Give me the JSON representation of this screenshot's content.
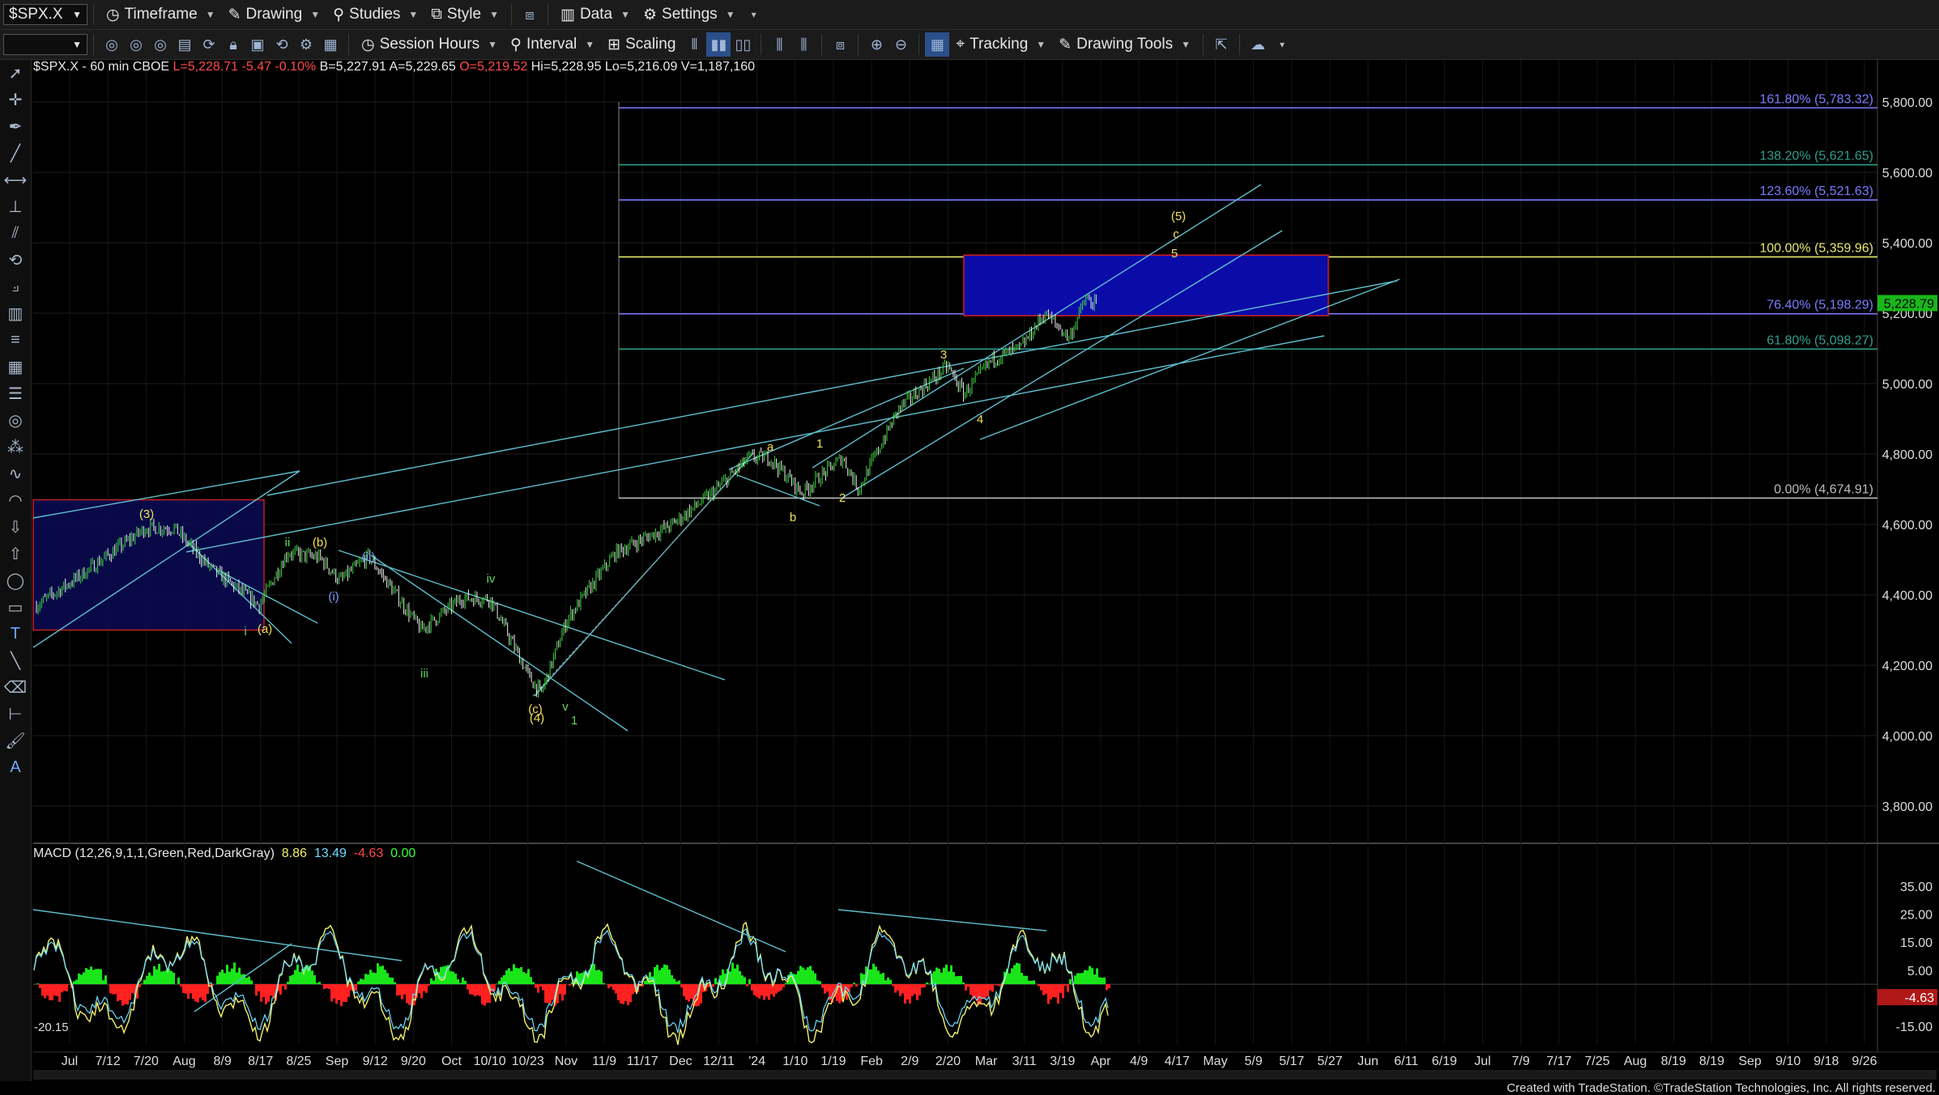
{
  "toolbar1": {
    "symbol": "$SPX.X",
    "items": [
      "Timeframe",
      "Drawing",
      "Studies",
      "Style",
      "Data",
      "Settings"
    ]
  },
  "toolbar2": {
    "items": [
      "Session Hours",
      "Interval",
      "Scaling",
      "Tracking",
      "Drawing Tools"
    ]
  },
  "header": {
    "symbol": "$SPX.X - 60 min",
    "exchange": "CBOE",
    "last": "L=5,228.71",
    "change": "-5.47",
    "change_pct": "-0.10%",
    "bid": "B=5,227.91",
    "ask": "A=5,229.65",
    "open": "O=5,219.52",
    "high": "Hi=5,228.95",
    "low": "Lo=5,216.09",
    "volume": "V=1,187,160"
  },
  "macd_header": {
    "label": "MACD (12,26,9,1,1,Green,Red,DarkGray)",
    "v1": "8.86",
    "v2": "13.49",
    "v3": "-4.63",
    "v4": "0.00",
    "colors": [
      "#f1f16c",
      "#6fdcff",
      "#ff4a4a",
      "#37ff37"
    ]
  },
  "price_axis": {
    "ticks": [
      "5,800.00",
      "5,600.00",
      "5,400.00",
      "5,200.00",
      "5,000.00",
      "4,800.00",
      "4,600.00",
      "4,400.00",
      "4,200.00",
      "4,000.00",
      "3,800.00"
    ],
    "last_price": "5,228.79"
  },
  "macd_axis": {
    "ticks": [
      "35.00",
      "25.00",
      "15.00",
      "5.00",
      "-15.00"
    ],
    "current": "-4.63",
    "min_label": "-20.15"
  },
  "time_axis": [
    "Jul",
    "7/12",
    "7/20",
    "Aug",
    "8/9",
    "8/17",
    "8/25",
    "Sep",
    "9/12",
    "9/20",
    "Oct",
    "10/10",
    "10/23",
    "Nov",
    "11/9",
    "11/17",
    "Dec",
    "12/11",
    "'24",
    "1/10",
    "1/19",
    "Feb",
    "2/9",
    "2/20",
    "Mar",
    "3/11",
    "3/19",
    "Apr",
    "4/9",
    "4/17",
    "May",
    "5/9",
    "5/17",
    "5/27",
    "Jun",
    "6/11",
    "6/19",
    "Jul",
    "7/9",
    "7/17",
    "7/25",
    "Aug",
    "8/19",
    "8/19",
    "Sep",
    "9/10",
    "9/18",
    "9/26"
  ],
  "fib_levels": [
    {
      "label": "161.80% (5,783.32)",
      "value": 5783.32,
      "color": "#7b7bff"
    },
    {
      "label": "138.20% (5,621.65)",
      "value": 5621.65,
      "color": "#2f9e8e"
    },
    {
      "label": "123.60% (5,521.63)",
      "value": 5521.63,
      "color": "#7b7bff"
    },
    {
      "label": "100.00% (5,359.96)",
      "value": 5359.96,
      "color": "#e8e86a"
    },
    {
      "label": "76.40% (5,198.29)",
      "value": 5198.29,
      "color": "#7b7bff"
    },
    {
      "label": "61.80% (5,098.27)",
      "value": 5098.27,
      "color": "#2f9e8e"
    },
    {
      "label": "0.00% (4,674.91)",
      "value": 4674.91,
      "color": "#bbbbbb"
    }
  ],
  "wave_labels": [
    {
      "text": "(3)",
      "color": "#f1e05a"
    },
    {
      "text": "ii",
      "color": "#5fd35f"
    },
    {
      "text": "(b)",
      "color": "#f1e05a"
    },
    {
      "text": "(ii)",
      "color": "#7a9cff"
    },
    {
      "text": "(i)",
      "color": "#7a9cff"
    },
    {
      "text": "i",
      "color": "#5fd35f"
    },
    {
      "text": "(a)",
      "color": "#f1e05a"
    },
    {
      "text": "iv",
      "color": "#5fd35f"
    },
    {
      "text": "iii",
      "color": "#5fd35f"
    },
    {
      "text": "(c)",
      "color": "#f1e05a"
    },
    {
      "text": "(4)",
      "color": "#f1e05a"
    },
    {
      "text": "v",
      "color": "#5fd35f"
    },
    {
      "text": "1",
      "color": "#5fd35f"
    },
    {
      "text": "a",
      "color": "#f1e05a"
    },
    {
      "text": "b",
      "color": "#f1e05a"
    },
    {
      "text": "1",
      "color": "#f1e05a"
    },
    {
      "text": "2",
      "color": "#f1e05a"
    },
    {
      "text": "3",
      "color": "#f1e05a"
    },
    {
      "text": "4",
      "color": "#f1e05a"
    },
    {
      "text": "(5)",
      "color": "#f1e05a"
    },
    {
      "text": "c",
      "color": "#f1e05a"
    },
    {
      "text": "5",
      "color": "#f1e05a"
    }
  ],
  "footer": "Created with TradeStation. ©TradeStation Technologies, Inc. All rights reserved."
}
